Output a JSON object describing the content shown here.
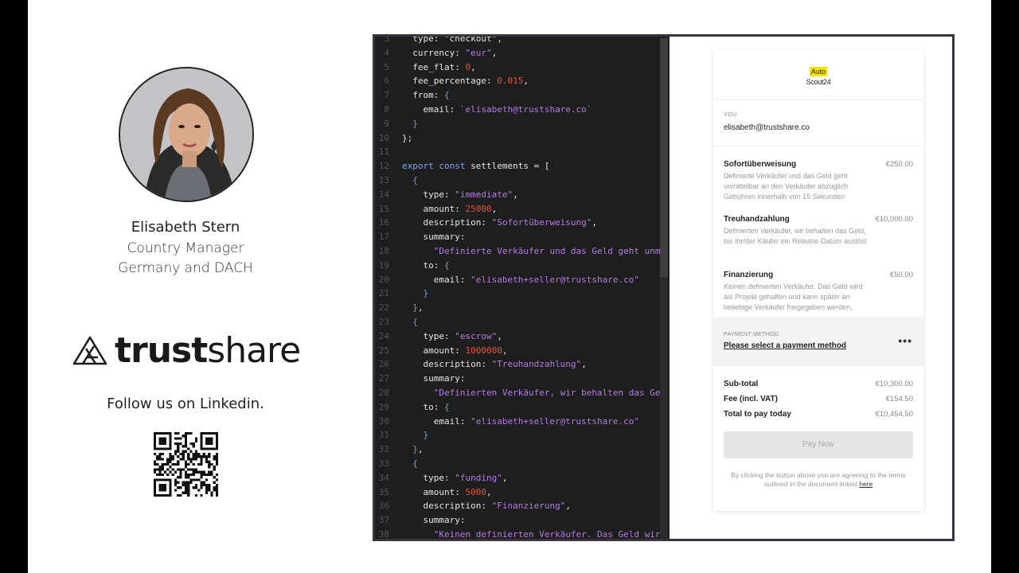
{
  "profile": {
    "name": "Elisabeth Stern",
    "role_line1": "Country Manager",
    "role_line2": "Germany and DACH"
  },
  "logo": {
    "text_bold": "trust",
    "text_light": "share"
  },
  "follow_text": "Follow us on Linkedin.",
  "code_lines": [
    {
      "n": "3",
      "html": "  type: \"checkout\","
    },
    {
      "n": "4",
      "html": "  currency: <span class='str'>\"eur\"</span>,"
    },
    {
      "n": "5",
      "html": "  fee_flat: <span class='num'>0</span>,"
    },
    {
      "n": "6",
      "html": "  fee_percentage: <span class='num'>0.015</span>,"
    },
    {
      "n": "7",
      "html": "  from: <span class='brace'>{</span>"
    },
    {
      "n": "8",
      "html": "    email: <span class='str'>`elisabeth@trustshare.co`</span>"
    },
    {
      "n": "9",
      "html": "  <span class='brace'>}</span>"
    },
    {
      "n": "10",
      "html": "};"
    },
    {
      "n": "11",
      "html": ""
    },
    {
      "n": "12",
      "html": "<span class='kw'>export const</span> settlements = ["
    },
    {
      "n": "13",
      "html": "  <span class='brace'>{</span>"
    },
    {
      "n": "14",
      "html": "    type: <span class='str'>\"immediate\"</span>,"
    },
    {
      "n": "15",
      "html": "    amount: <span class='num'>25000</span>,"
    },
    {
      "n": "16",
      "html": "    description: <span class='str'>\"Sofortüberweisung\"</span>,"
    },
    {
      "n": "17",
      "html": "    summary:"
    },
    {
      "n": "18",
      "html": "      <span class='str'>\"Definierte Verkäufer und das Geld geht unmitte</span>"
    },
    {
      "n": "19",
      "html": "    to: <span class='brace'>{</span>"
    },
    {
      "n": "20",
      "html": "      email: <span class='str'>\"elisabeth+seller@trustshare.co\"</span>"
    },
    {
      "n": "21",
      "html": "    <span class='brace'>}</span>"
    },
    {
      "n": "22",
      "html": "  <span class='brace'>}</span>,"
    },
    {
      "n": "23",
      "html": "  <span class='brace'>{</span>"
    },
    {
      "n": "24",
      "html": "    type: <span class='str'>\"escrow\"</span>,"
    },
    {
      "n": "25",
      "html": "    amount: <span class='num'>1000000</span>,"
    },
    {
      "n": "26",
      "html": "    description: <span class='str'>\"Treuhandzahlung\"</span>,"
    },
    {
      "n": "27",
      "html": "    summary:"
    },
    {
      "n": "28",
      "html": "      <span class='str'>\"Definierten Verkäufer, wir behalten das Geld,</span>"
    },
    {
      "n": "29",
      "html": "    to: <span class='brace'>{</span>"
    },
    {
      "n": "30",
      "html": "      email: <span class='str'>\"elisabeth+seller@trustshare.co\"</span>"
    },
    {
      "n": "31",
      "html": "    <span class='brace'>}</span>"
    },
    {
      "n": "32",
      "html": "  <span class='brace'>}</span>,"
    },
    {
      "n": "33",
      "html": "  <span class='brace'>{</span>"
    },
    {
      "n": "34",
      "html": "    type: <span class='str'>\"funding\"</span>,"
    },
    {
      "n": "35",
      "html": "    amount: <span class='num'>5000</span>,"
    },
    {
      "n": "36",
      "html": "    description: <span class='str'>\"Finanzierung\"</span>,"
    },
    {
      "n": "37",
      "html": "    summary:"
    },
    {
      "n": "38",
      "html": "      <span class='str'>\"Keinen definierten Verkäufer. Das Geld wird al</span>"
    }
  ],
  "checkout": {
    "brand_top": "Auto",
    "brand_bottom": "Scout24",
    "you_label": "YOU",
    "you_email": "elisabeth@trustshare.co",
    "items": [
      {
        "title": "Sofortüberweisung",
        "price": "€250.00",
        "desc": "Definierte Verkäufer und das Geld geht unmittelbar an den Verkäufer abzüglich Gebühren innerhalb von 15 Sekunden"
      },
      {
        "title": "Treuhandzahlung",
        "price": "€10,000.00",
        "desc": "Definierten Verkäufer, wir behalten das Geld, bis Ihr/der Käufer ein Release-Datum auslöst"
      },
      {
        "title": "Finanzierung",
        "price": "€50.00",
        "desc": "Keinen definierten Verkäufer. Das Geld wird als Projekt gehalten und kann später an beliebige Verkäufer freigegeben werden,"
      }
    ],
    "payment_method_label": "PAYMENT METHOD",
    "payment_method_link": "Please select a payment method",
    "more": "•••",
    "subtotal_label": "Sub-total",
    "subtotal_value": "€10,300.00",
    "fee_label": "Fee (incl. VAT)",
    "fee_value": "€154.50",
    "total_label": "Total to pay today",
    "total_value": "€10,454.50",
    "pay_button": "Pay Now",
    "terms_text": "By clicking the button above you are agreeing to the terms outlined in the document linked ",
    "terms_link": "here"
  }
}
